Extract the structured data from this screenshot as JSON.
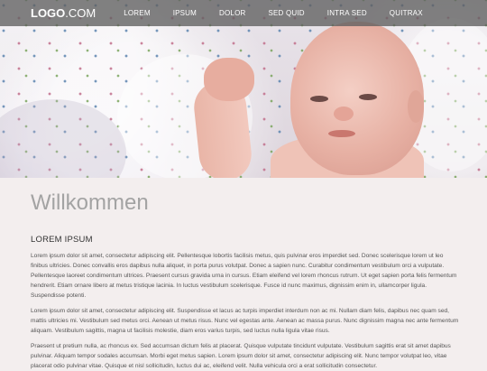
{
  "nav": {
    "logo_bold": "LOGO",
    "logo_light": ".COM",
    "items": [
      {
        "label": "LOREM"
      },
      {
        "label": "IPSUM"
      },
      {
        "label": "DOLOR"
      },
      {
        "label": "SED QUID"
      },
      {
        "label": "INTRA SED"
      },
      {
        "label": "QUITRAX"
      }
    ]
  },
  "hero": {
    "image_subject": "baby-lying-on-patterned-blanket"
  },
  "main": {
    "title": "Willkommen",
    "section_heading": "LOREM IPSUM",
    "paragraphs": [
      "Lorem ipsum dolor sit amet, consectetur adipiscing elit. Pellentesque lobortis facilisis metus, quis pulvinar eros imperdiet sed. Donec scelerisque lorem ut leo finibus ultricies. Donec convallis eros dapibus nulla aliquet, in porta purus volutpat. Donec a sapien nunc. Curabitur condimentum vestibulum orci a vulputate. Pellentesque laoreet condimentum ultrices. Praesent cursus gravida urna in cursus. Etiam eleifend vel lorem rhoncus rutrum. Ut eget sapien porta felis fermentum hendrerit. Etiam ornare libero at metus tristique lacinia. In luctus vestibulum scelerisque. Fusce id nunc maximus, dignissim enim in, ullamcorper ligula. Suspendisse potenti.",
      "Lorem ipsum dolor sit amet, consectetur adipiscing elit. Suspendisse et lacus ac turpis imperdiet interdum non ac mi. Nullam diam felis, dapibus nec quam sed, mattis ultricies mi. Vestibulum sed metus orci. Aenean ut metus risus. Nunc vel egestas ante. Aenean ac massa purus. Nunc dignissim magna nec ante fermentum aliquam. Vestibulum sagittis, magna ut facilisis molestie, diam eros varius turpis, sed luctus nulla ligula vitae risus.",
      "Praesent ut pretium nulla, ac rhoncus ex. Sed accumsan dictum felis at placerat. Quisque vulputate tincidunt vulputate. Vestibulum sagittis erat sit amet dapibus pulvinar. Aliquam tempor sodales accumsan. Morbi eget metus sapien. Lorem ipsum dolor sit amet, consectetur adipiscing elit. Nunc tempor volutpat leo, vitae placerat odio pulvinar vitae. Quisque et nisl sollicitudin, luctus dui ac, eleifend velit. Nulla vehicula orci a erat sollicitudin consectetur."
    ]
  },
  "colors": {
    "nav_bg": "#5f5f5f",
    "page_bg": "#f3eeee",
    "title": "#a3a3a3",
    "body_text": "#555555"
  }
}
